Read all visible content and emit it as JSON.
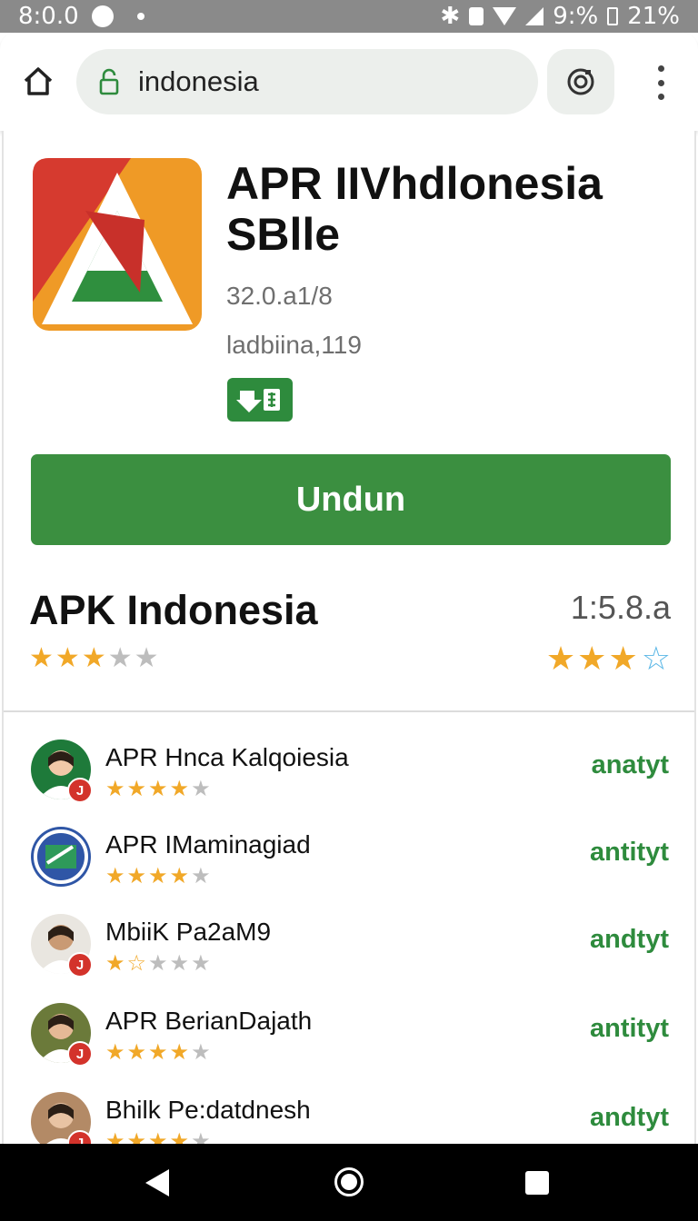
{
  "status_bar": {
    "time": "8:0.0",
    "battery_text": "9:%",
    "extra_text": "21%"
  },
  "browser": {
    "url": "indonesia"
  },
  "app": {
    "title": "APR IIVhdlonesia SBlle",
    "version": "32.0.a1/8",
    "date": "ladbiina,119",
    "download_label": "Undun"
  },
  "rating": {
    "title": "APK Indonesia",
    "score": "1:5.8.a",
    "left_stars": 3,
    "right_stars": 3
  },
  "list": [
    {
      "title": "APR Hnca Kalqoiesia",
      "stars": 4,
      "action": "anatyt",
      "badge": "J"
    },
    {
      "title": "APR IMaminagiad",
      "stars": 4,
      "action": "antityt",
      "badge": ""
    },
    {
      "title": "MbiiK Pa2aM9",
      "stars": 1.5,
      "action": "andtyt",
      "badge": "J"
    },
    {
      "title": "APR BerianDajath",
      "stars": 4,
      "action": "antityt",
      "badge": "J"
    },
    {
      "title": "Bhilk Pe:datdnesh",
      "stars": 4,
      "action": "andtyt",
      "badge": "J"
    }
  ],
  "colors": {
    "accent_green": "#3b8f40",
    "star_yellow": "#f1a828",
    "status_bar": "#8a8a8a"
  }
}
